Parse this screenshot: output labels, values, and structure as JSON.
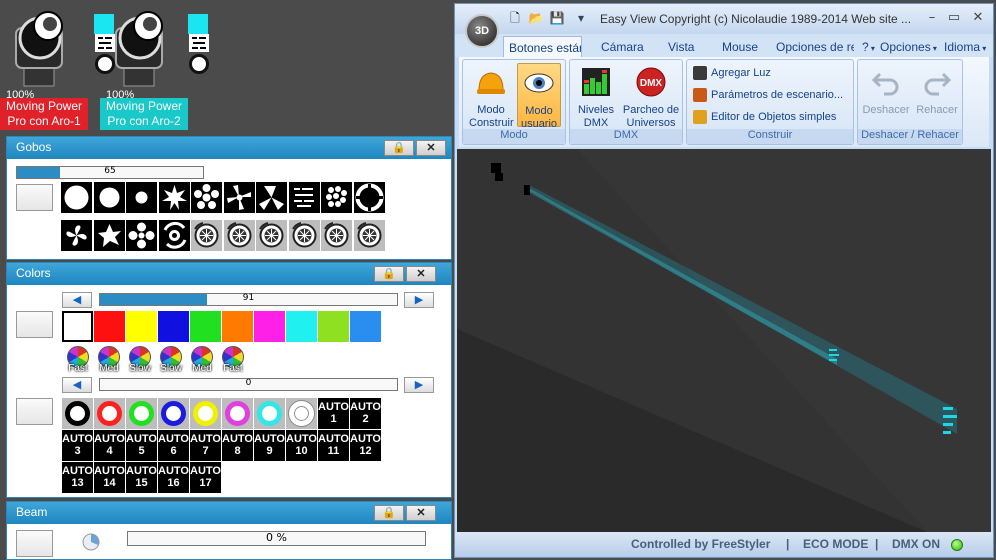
{
  "fixtures": [
    {
      "percent": "100%",
      "label": "Moving Power Pro con Aro-1",
      "label_color": "#e0212a",
      "swatch": "#19e6f0"
    },
    {
      "percent": "100%",
      "label": "Moving Power Pro con Aro-2",
      "label_color": "#19c8c8",
      "swatch": "#19e6f0"
    }
  ],
  "gobos_panel": {
    "title": "Gobos",
    "lock_icon": "lock-icon",
    "close_icon": "close-icon",
    "slider_value": "65",
    "slider_level": 0.23
  },
  "colors_panel": {
    "title": "Colors",
    "slider1_value": "91",
    "slider1_level": 0.36,
    "slider2_value": "0",
    "slider2_level": 0,
    "swatches": [
      "#ffffff",
      "#ff1010",
      "#ffff00",
      "#1010e0",
      "#20e020",
      "#ff7a00",
      "#ff20e8",
      "#20f0f0",
      "#8ee020",
      "#2a8ef0"
    ],
    "wheel_labels": [
      "Fast",
      "Med",
      "Slow",
      "Slow",
      "Med",
      "Fast"
    ],
    "ring_colors": [
      "#111111",
      "#ff2020",
      "#20e020",
      "#1a1ae0",
      "#f0f000",
      "#e040e0",
      "#30e8e8",
      "#ffffff"
    ],
    "ring_labels": [
      "",
      "",
      "",
      "",
      "",
      "",
      "",
      ""
    ],
    "auto_word": "AUTO",
    "auto_first": [
      "1",
      "2"
    ],
    "auto_rows": [
      [
        "3",
        "4",
        "5",
        "6",
        "7",
        "8",
        "9",
        "10",
        "11",
        "12"
      ],
      [
        "13",
        "14",
        "15",
        "16",
        "17"
      ]
    ]
  },
  "beam_panel": {
    "title": "Beam",
    "slider_value": "0 %",
    "slider_level": 0
  },
  "app": {
    "logo": "3D",
    "title": "Easy View   Copyright (c) Nicolaudie 1989-2014   Web site ...",
    "minimize": "–",
    "maximize": "▭",
    "close": "✕",
    "tabs": [
      "Botones estándar",
      "Cámara",
      "Vista",
      "Mouse",
      "Opciones de re",
      "?",
      "Opciones",
      "Idioma"
    ],
    "groups": {
      "modo": {
        "label": "Modo",
        "buttons": [
          "Modo Construir",
          "Modo usuario"
        ]
      },
      "dmx": {
        "label": "DMX",
        "buttons": [
          "Niveles DMX",
          "Parcheo de Universos"
        ]
      },
      "construir": {
        "label": "Construir",
        "items": [
          "Agregar Luz",
          "Parámetros de escenario...",
          "Editor de Objetos simples"
        ]
      },
      "undo": {
        "label": "Deshacer / Rehacer",
        "buttons": [
          "Deshacer",
          "Rehacer"
        ]
      }
    },
    "status": {
      "controlled": "Controlled by FreeStyler",
      "sep1": "|",
      "eco": "ECO MODE",
      "sep2": "|",
      "dmx": "DMX ON"
    }
  }
}
